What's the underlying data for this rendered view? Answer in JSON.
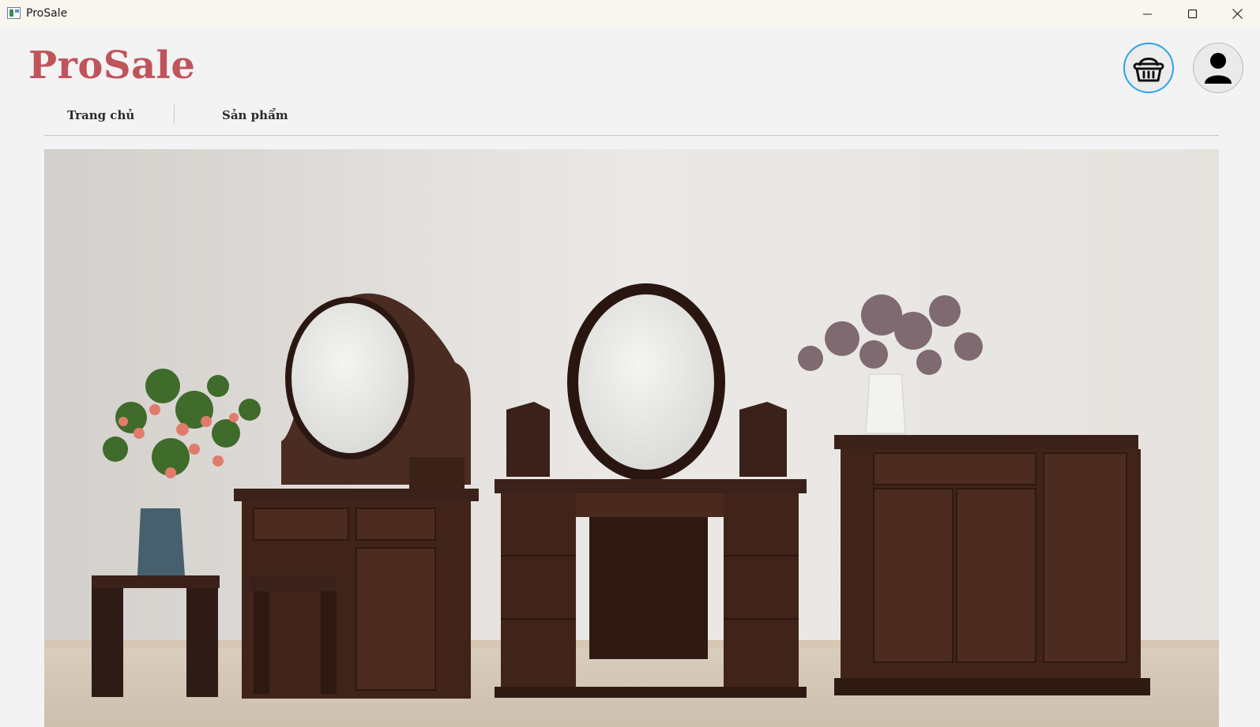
{
  "window": {
    "title": "ProSale",
    "controls": [
      "minimize",
      "maximize",
      "close"
    ]
  },
  "header": {
    "logo": "ProSale",
    "cart_icon": "basket-icon",
    "user_icon": "user-icon"
  },
  "nav": {
    "items": [
      {
        "label": "Trang chủ"
      },
      {
        "label": "Sản phẩm"
      }
    ]
  },
  "hero": {
    "subject": "furniture-showroom-image"
  },
  "colors": {
    "brand": "#c0545b",
    "accent": "#2aa4ea",
    "background": "#f3f3f3"
  }
}
